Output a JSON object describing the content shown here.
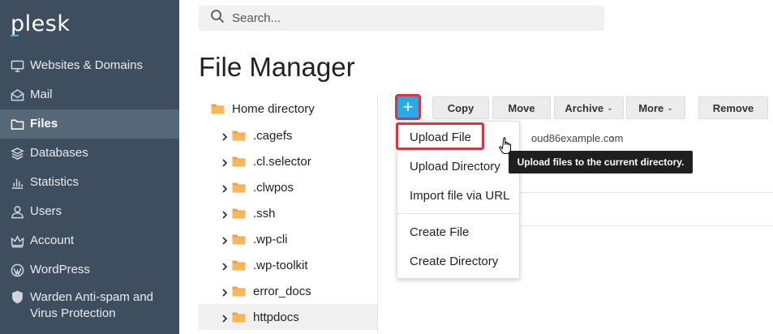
{
  "brand": {
    "logo_text": "plesk",
    "accent": "#37b3f0"
  },
  "sidebar": {
    "items": [
      {
        "label": "Websites & Domains",
        "icon": "monitor-icon"
      },
      {
        "label": "Mail",
        "icon": "envelope-icon"
      },
      {
        "label": "Files",
        "icon": "folder-icon",
        "active": true
      },
      {
        "label": "Databases",
        "icon": "layers-icon"
      },
      {
        "label": "Statistics",
        "icon": "bar-chart-icon"
      },
      {
        "label": "Users",
        "icon": "user-icon"
      },
      {
        "label": "Account",
        "icon": "crown-icon"
      },
      {
        "label": "WordPress",
        "icon": "wordpress-icon"
      },
      {
        "label": "Warden Anti-spam and Virus Protection",
        "icon": "shield-icon"
      }
    ]
  },
  "search": {
    "placeholder": "Search..."
  },
  "page": {
    "title": "File Manager"
  },
  "tree": {
    "root": "Home directory",
    "children": [
      ".cagefs",
      ".cl.selector",
      ".clwpos",
      ".ssh",
      ".wp-cli",
      ".wp-toolkit",
      "error_docs",
      "httpdocs"
    ],
    "selected": "httpdocs"
  },
  "toolbar": {
    "add_symbol": "+",
    "copy": "Copy",
    "move": "Move",
    "archive": "Archive",
    "more": "More",
    "remove": "Remove",
    "caret": "⌄"
  },
  "breadcrumb": {
    "text": "oud86example.com",
    "chevron": "›"
  },
  "dropdown": {
    "items": [
      "Upload File",
      "Upload Directory",
      "Import file via URL",
      "Create File",
      "Create Directory"
    ]
  },
  "tooltip": {
    "text": "Upload files to the current directory."
  },
  "colors": {
    "sidebar_bg": "#3e4e5e",
    "sidebar_active": "#566778",
    "primary": "#28a9e8",
    "highlight": "#d9343f",
    "folder": "#f0a040"
  }
}
